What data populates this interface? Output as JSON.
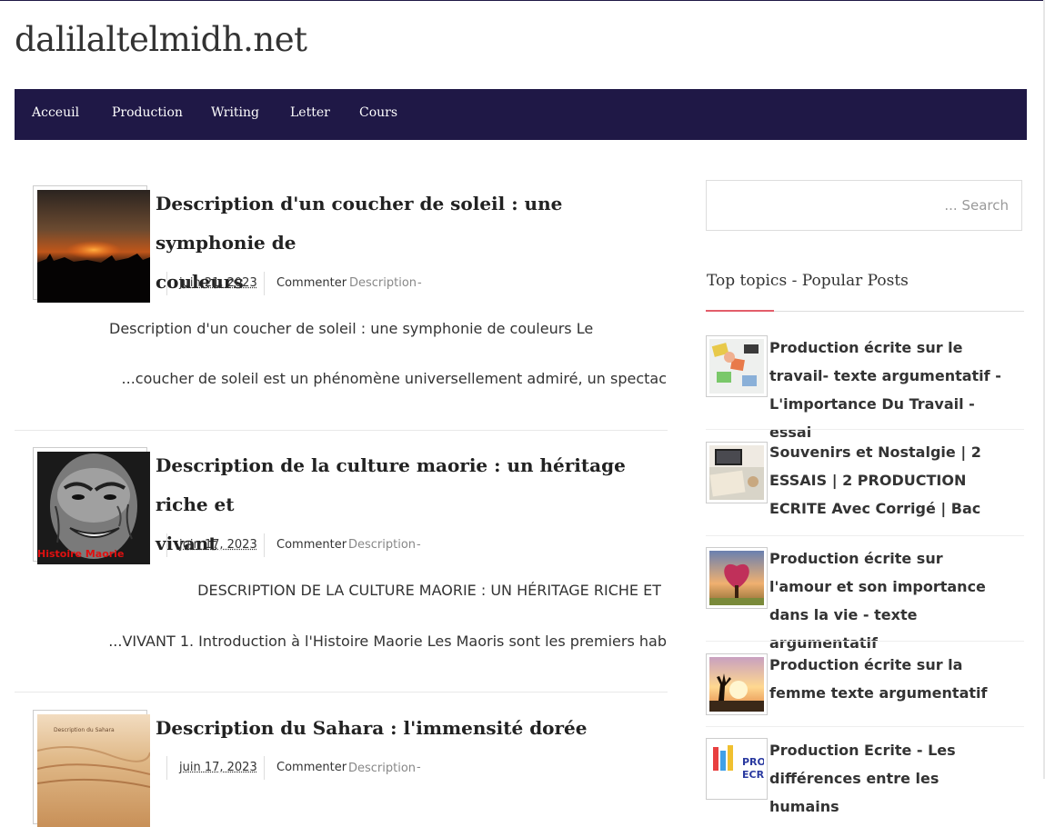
{
  "site": {
    "title": "dalilaltelmidh.net"
  },
  "nav": {
    "items": [
      {
        "label": "Acceuil"
      },
      {
        "label": "Production"
      },
      {
        "label": "Writing"
      },
      {
        "label": "Letter"
      },
      {
        "label": "Cours"
      }
    ]
  },
  "posts": [
    {
      "title_line1": "Description d'un coucher de soleil : une symphonie de",
      "title_line2": "couleurs",
      "date": "juin 21, 2023",
      "comment": "Commenter",
      "category": "Description",
      "dash": "-",
      "excerpt_line1": "Description d'un coucher de soleil : une symphonie de couleurs Le",
      "excerpt_line2": "...coucher de soleil est un phénomène universellement admiré, un spectac"
    },
    {
      "title_line1": "Description de la culture maorie : un héritage riche et",
      "title_line2": "vivant",
      "date": "juin 17, 2023",
      "comment": "Commenter",
      "category": "Description",
      "dash": "-",
      "image_caption": "Histoire Maorie",
      "excerpt_line1": "DESCRIPTION DE LA CULTURE MAORIE : UN HÉRITAGE RICHE ET",
      "excerpt_line2": "...VIVANT 1. Introduction à l'Histoire Maorie    Les Maoris sont les premiers hab"
    },
    {
      "title_line1": "Description du Sahara : l'immensité dorée",
      "date": "juin 17, 2023",
      "comment": "Commenter",
      "category": "Description",
      "dash": "-",
      "image_caption": "Description du Sahara"
    }
  ],
  "sidebar": {
    "search_placeholder": "... Search",
    "widget_title": "Top topics - Popular Posts",
    "popular": [
      {
        "title": "Production écrite sur le travail- texte argumentatif - L'importance Du Travail - essai"
      },
      {
        "title": "Souvenirs et Nostalgie | 2 ESSAIS | 2 PRODUCTION ECRITE Avec Corrigé | Bac"
      },
      {
        "title": "Production écrite sur l'amour et son importance dans la vie - texte argumentatif"
      },
      {
        "title": "Production écrite sur la femme texte argumentatif"
      },
      {
        "title": "Production Ecrite - Les différences entre les humains",
        "thumb_text": "PRO ECR"
      }
    ]
  },
  "colors": {
    "nav_bg": "#1f1846",
    "accent": "#e35d6a"
  }
}
